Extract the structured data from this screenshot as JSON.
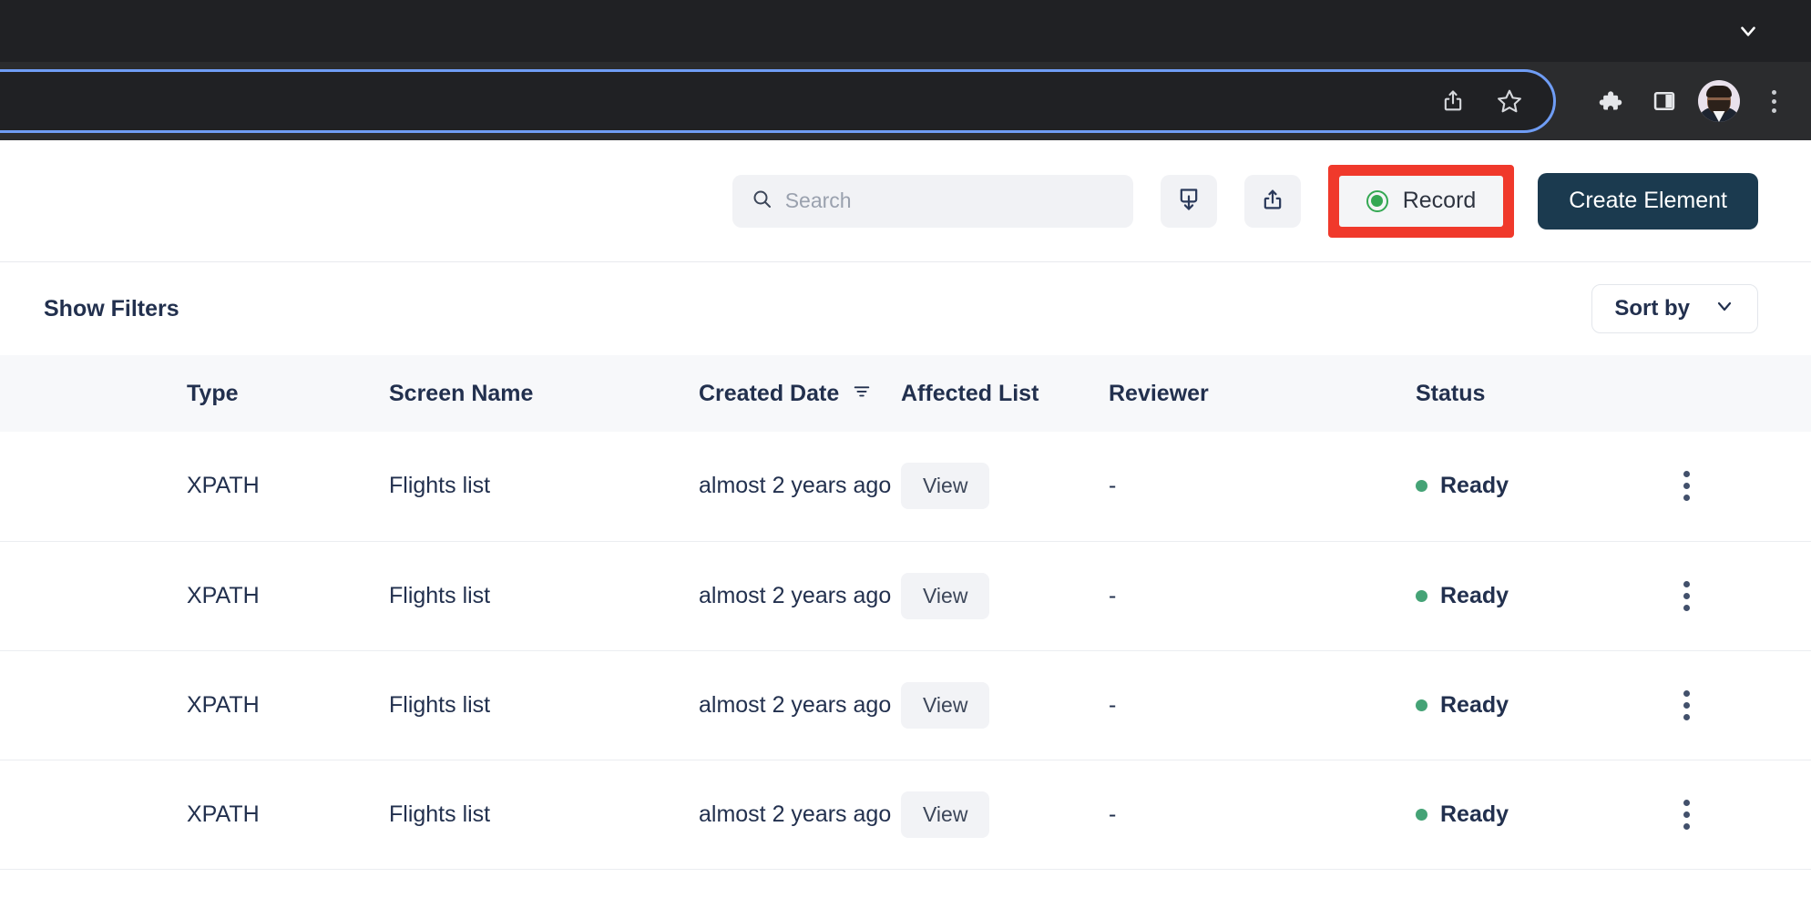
{
  "browser": {
    "tabstrip": {
      "chevron_icon": "chevron-down-icon"
    },
    "omnibox": {
      "value": "",
      "placeholder": "",
      "icons": [
        "share-icon",
        "bookmark-star-icon"
      ]
    },
    "toolbar_icons": [
      "extensions-puzzle-icon",
      "side-panel-icon",
      "profile-avatar",
      "browser-menu-icon"
    ]
  },
  "app_header": {
    "search": {
      "value": "",
      "placeholder": "Search",
      "icon": "search-icon"
    },
    "import_button": {
      "label": "",
      "icon": "download-icon"
    },
    "export_button": {
      "label": "",
      "icon": "upload-share-icon"
    },
    "record_button": {
      "label": "Record",
      "icon": "record-circle-icon",
      "highlight_color": "#f0392b",
      "dot_color": "#34a853"
    },
    "create_element_button": {
      "label": "Create Element",
      "bg_color": "#1b3a4f"
    }
  },
  "filters_bar": {
    "show_filters_label": "Show Filters",
    "sort_by_label": "Sort by",
    "sort_by_icon": "chevron-down-icon"
  },
  "table": {
    "columns": [
      {
        "key": "select",
        "label": ""
      },
      {
        "key": "type",
        "label": "Type"
      },
      {
        "key": "screen_name",
        "label": "Screen Name"
      },
      {
        "key": "created_date",
        "label": "Created Date",
        "icon": "sort-filter-icon"
      },
      {
        "key": "affected_list",
        "label": "Affected List"
      },
      {
        "key": "reviewer",
        "label": "Reviewer"
      },
      {
        "key": "status",
        "label": "Status"
      },
      {
        "key": "menu",
        "label": ""
      }
    ],
    "rows": [
      {
        "type": "XPATH",
        "screen_name": "Flights list",
        "created_date": "almost 2 years ago",
        "affected_list": "View",
        "reviewer": "-",
        "status": "Ready",
        "status_color": "#45a376",
        "menu_icon": "kebab-menu-icon"
      },
      {
        "type": "XPATH",
        "screen_name": "Flights list",
        "created_date": "almost 2 years ago",
        "affected_list": "View",
        "reviewer": "-",
        "status": "Ready",
        "status_color": "#45a376",
        "menu_icon": "kebab-menu-icon"
      },
      {
        "type": "XPATH",
        "screen_name": "Flights list",
        "created_date": "almost 2 years ago",
        "affected_list": "View",
        "reviewer": "-",
        "status": "Ready",
        "status_color": "#45a376",
        "menu_icon": "kebab-menu-icon"
      },
      {
        "type": "XPATH",
        "screen_name": "Flights list",
        "created_date": "almost 2 years ago",
        "affected_list": "View",
        "reviewer": "-",
        "status": "Ready",
        "status_color": "#45a376",
        "menu_icon": "kebab-menu-icon"
      }
    ]
  }
}
